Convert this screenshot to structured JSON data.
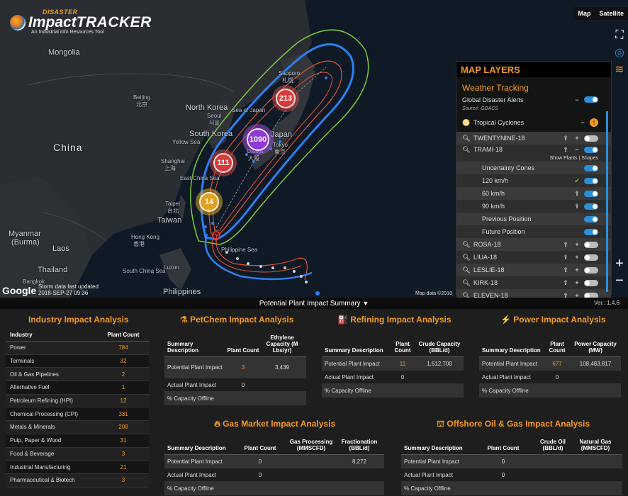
{
  "logo": {
    "top": "DISASTER",
    "main_a": "Impact",
    "main_b": "TRACKER",
    "tag": "An Industrial Info Resources Tool"
  },
  "map_type": {
    "map": "Map",
    "satellite": "Satellite"
  },
  "map_labels": {
    "mongolia": "Mongolia",
    "china": "China",
    "north_korea": "North Korea",
    "seoul": "Seoul",
    "seoul_local": "서울",
    "south_korea": "South Korea",
    "yellow_sea": "Yellow Sea",
    "sea_of_japan": "Sea of Japan",
    "japan": "Japan",
    "beijing": "Beijing",
    "beijing_local": "北京",
    "shanghai": "Shanghai",
    "shanghai_local": "上海",
    "east_china_sea": "East China Sea",
    "taipei": "Taipei",
    "taipei_local": "台北",
    "taiwan": "Taiwan",
    "hong_kong": "Hong Kong",
    "hong_kong_local": "香港",
    "south_china_sea": "South China Sea",
    "philippine_sea": "Philippine Sea",
    "myanmar": "Myanmar",
    "burma": "(Burma)",
    "laos": "Laos",
    "thailand": "Thailand",
    "bangkok": "Bangkok",
    "luzon": "Luzon",
    "philippines": "Philippines",
    "sapporo": "Sapporo",
    "sapporo_local": "札幌",
    "tokyo": "Tokyo",
    "tokyo_local": "東京",
    "osaka": "Osaka",
    "osaka_local": "大阪"
  },
  "clusters": {
    "c1": "213",
    "c2": "1090",
    "c3": "111",
    "c4": "14"
  },
  "google": "Google",
  "storm_time": {
    "line1": "Storm data last updated",
    "line2": "2018-SEP-27 09:36"
  },
  "map_data": "Map data ©2018",
  "layers": {
    "title": "MAP LAYERS",
    "weather": "Weather Tracking",
    "alerts": "Global Disaster Alerts",
    "source": "Source: GDACS",
    "cyclones": "Tropical Cyclones",
    "cyclone_badge": "!",
    "show_plants": "Show Plants | Shapes",
    "items": {
      "twentynine": "TWENTYNINE-18",
      "trami": "TRAMI-18",
      "cones": "Uncertainty Cones",
      "kmh120": "120 km/h",
      "kmh60": "60 km/h",
      "kmh90": "90 km/h",
      "prev": "Previous Position",
      "future": "Future Position",
      "rosa": "ROSA-18",
      "liua": "LIUA-18",
      "leslie": "LESLIE-18",
      "kirk": "KIRK-18",
      "eleven": "ELEVEN-18"
    }
  },
  "summary_bar": {
    "title": "Potential Plant Impact Summary",
    "version": "Ver.: 1.4.6"
  },
  "industry": {
    "title": "Industry Impact Analysis",
    "col1": "Industry",
    "col2": "Plant Count",
    "rows": [
      {
        "name": "Power",
        "count": "784"
      },
      {
        "name": "Terminals",
        "count": "32"
      },
      {
        "name": "Oil & Gas Pipelines",
        "count": "2"
      },
      {
        "name": "Alternative Fuel",
        "count": "1"
      },
      {
        "name": "Petroleum Refining (HPI)",
        "count": "12"
      },
      {
        "name": "Chemical Processing (CPI)",
        "count": "331"
      },
      {
        "name": "Metals & Minerals",
        "count": "208"
      },
      {
        "name": "Pulp, Paper & Wood",
        "count": "31"
      },
      {
        "name": "Food & Beverage",
        "count": "3"
      },
      {
        "name": "Industrial Manufacturing",
        "count": "21"
      },
      {
        "name": "Pharmaceutical & Biotech",
        "count": "3"
      }
    ]
  },
  "petchem": {
    "title": "PetChem Impact Analysis",
    "h1": "Summary Description",
    "h2": "Plant Count",
    "h3": "Ethylene Capacity (M Lbs/yr)",
    "r1": {
      "d": "Potential Plant Impact",
      "c": "3",
      "v": "3,439"
    },
    "r2": {
      "d": "Actual Plant Impact",
      "c": "0",
      "v": ""
    },
    "r3": {
      "d": "% Capacity Offline",
      "c": "",
      "v": ""
    }
  },
  "refining": {
    "title": "Refining Impact Analysis",
    "h1": "Summary Description",
    "h2": "Plant Count",
    "h3": "Crude Capacity (BBL/d)",
    "r1": {
      "d": "Potential Plant Impact",
      "c": "11",
      "v": "1,612,700"
    },
    "r2": {
      "d": "Actual Plant Impact",
      "c": "0",
      "v": ""
    },
    "r3": {
      "d": "% Capacity Offline",
      "c": "",
      "v": ""
    }
  },
  "power": {
    "title": "Power Impact Analysis",
    "h1": "Summary Description",
    "h2": "Plant Count",
    "h3": "Power Capacity (MW)",
    "r1": {
      "d": "Potential Plant Impact",
      "c": "677",
      "v": "108,483.817"
    },
    "r2": {
      "d": "Actual Plant Impact",
      "c": "0",
      "v": ""
    },
    "r3": {
      "d": "% Capacity Offline",
      "c": "",
      "v": ""
    }
  },
  "gas": {
    "title": "Gas Market Impact Analysis",
    "h1": "Summary Description",
    "h2": "Plant Count",
    "h3": "Gas Processing (MMSCFD)",
    "h4": "Fractionation (BBL/d)",
    "r1": {
      "d": "Potential Plant Impact",
      "c": "0",
      "v": "",
      "f": "8,272"
    },
    "r2": {
      "d": "Actual Plant Impact",
      "c": "0",
      "v": "",
      "f": ""
    },
    "r3": {
      "d": "% Capacity Offline",
      "c": "",
      "v": "",
      "f": ""
    }
  },
  "offshore": {
    "title": "Offshore Oil & Gas Impact Analysis",
    "h1": "Summary Description",
    "h2": "Plant Count",
    "h3": "Crude Oil (BBL/d)",
    "h4": "Natural Gas (MMSCFD)",
    "r1": {
      "d": "Potential Plant Impact",
      "c": "0",
      "v": "",
      "f": ""
    },
    "r2": {
      "d": "Actual Plant Impact",
      "c": "0",
      "v": "",
      "f": ""
    },
    "r3": {
      "d": "% Capacity Offline",
      "c": "",
      "v": "",
      "f": ""
    }
  }
}
